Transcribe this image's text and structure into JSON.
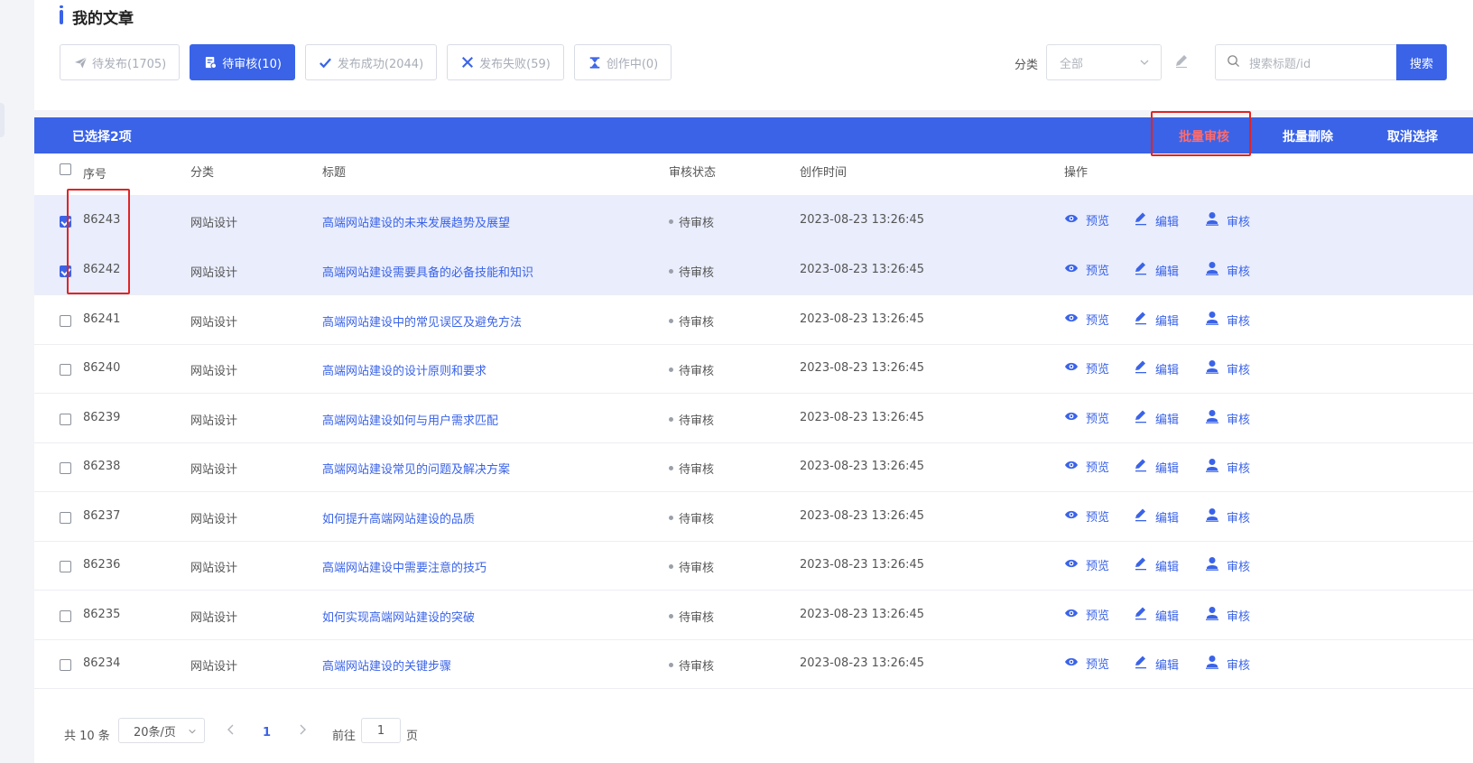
{
  "page": {
    "title": "我的文章"
  },
  "tabs": [
    {
      "label": "待发布(1705)",
      "icon": "send-icon",
      "active": false
    },
    {
      "label": "待审核(10)",
      "icon": "review-doc-icon",
      "active": true
    },
    {
      "label": "发布成功(2044)",
      "icon": "check-icon",
      "active": false
    },
    {
      "label": "发布失败(59)",
      "icon": "close-icon",
      "active": false
    },
    {
      "label": "创作中(0)",
      "icon": "hourglass-icon",
      "active": false
    }
  ],
  "filter": {
    "category_label": "分类",
    "category_value": "全部",
    "search_placeholder": "搜索标题/id",
    "search_button": "搜索"
  },
  "selection_bar": {
    "count_text": "已选择2项",
    "batch_approve": "批量审核",
    "batch_delete": "批量删除",
    "cancel_select": "取消选择"
  },
  "table": {
    "headers": {
      "id": "序号",
      "category": "分类",
      "title": "标题",
      "status": "审核状态",
      "created": "创作时间",
      "ops": "操作"
    },
    "op_labels": {
      "preview": "预览",
      "edit": "编辑",
      "review": "审核"
    },
    "rows": [
      {
        "id": "86243",
        "category": "网站设计",
        "title": "高端网站建设的未来发展趋势及展望",
        "status": "待审核",
        "created": "2023-08-23 13:26:45",
        "checked": true
      },
      {
        "id": "86242",
        "category": "网站设计",
        "title": "高端网站建设需要具备的必备技能和知识",
        "status": "待审核",
        "created": "2023-08-23 13:26:45",
        "checked": true
      },
      {
        "id": "86241",
        "category": "网站设计",
        "title": "高端网站建设中的常见误区及避免方法",
        "status": "待审核",
        "created": "2023-08-23 13:26:45",
        "checked": false
      },
      {
        "id": "86240",
        "category": "网站设计",
        "title": "高端网站建设的设计原则和要求",
        "status": "待审核",
        "created": "2023-08-23 13:26:45",
        "checked": false
      },
      {
        "id": "86239",
        "category": "网站设计",
        "title": "高端网站建设如何与用户需求匹配",
        "status": "待审核",
        "created": "2023-08-23 13:26:45",
        "checked": false
      },
      {
        "id": "86238",
        "category": "网站设计",
        "title": "高端网站建设常见的问题及解决方案",
        "status": "待审核",
        "created": "2023-08-23 13:26:45",
        "checked": false
      },
      {
        "id": "86237",
        "category": "网站设计",
        "title": "如何提升高端网站建设的品质",
        "status": "待审核",
        "created": "2023-08-23 13:26:45",
        "checked": false
      },
      {
        "id": "86236",
        "category": "网站设计",
        "title": "高端网站建设中需要注意的技巧",
        "status": "待审核",
        "created": "2023-08-23 13:26:45",
        "checked": false
      },
      {
        "id": "86235",
        "category": "网站设计",
        "title": "如何实现高端网站建设的突破",
        "status": "待审核",
        "created": "2023-08-23 13:26:45",
        "checked": false
      },
      {
        "id": "86234",
        "category": "网站设计",
        "title": "高端网站建设的关键步骤",
        "status": "待审核",
        "created": "2023-08-23 13:26:45",
        "checked": false
      }
    ]
  },
  "pagination": {
    "total_text": "共 10 条",
    "page_size": "20条/页",
    "current_page": "1",
    "goto_label": "前往",
    "goto_value": "1",
    "page_suffix": "页"
  },
  "colors": {
    "accent": "#3a63e8",
    "highlight_box": "#e02424",
    "approve_text": "#ff6b6b",
    "selected_row": "#e9edfc"
  }
}
